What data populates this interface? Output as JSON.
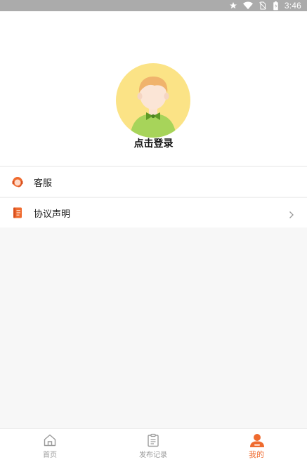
{
  "status_bar": {
    "time": "3:46"
  },
  "profile": {
    "login_prompt": "点击登录"
  },
  "menu": {
    "items": [
      {
        "label": "客服",
        "icon": "headset-icon"
      },
      {
        "label": "协议声明",
        "icon": "document-icon"
      }
    ]
  },
  "bottom_nav": {
    "items": [
      {
        "label": "首页",
        "icon": "home-icon"
      },
      {
        "label": "发布记录",
        "icon": "clipboard-icon"
      },
      {
        "label": "我的",
        "icon": "user-icon",
        "active": true
      }
    ]
  },
  "colors": {
    "accent": "#ef6b2f",
    "avatar_bg": "#fbe386"
  }
}
